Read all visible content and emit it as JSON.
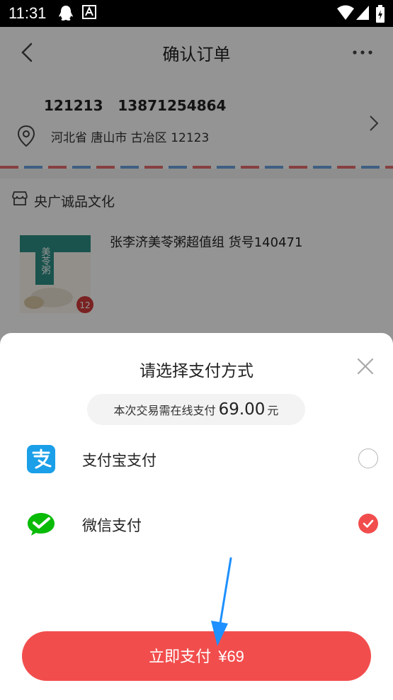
{
  "status_bar": {
    "time": "11:31"
  },
  "nav": {
    "title": "确认订单"
  },
  "address": {
    "name": "121213",
    "phone": "13871254864",
    "detail": "河北省 唐山市 古冶区  12123"
  },
  "store": {
    "name": "央广诚品文化"
  },
  "product": {
    "title": "张李济美苓粥超值组 货号140471",
    "image_text": "美苓粥",
    "badge": "12"
  },
  "sheet": {
    "title": "请选择支付方式",
    "amount_prefix": "本次交易需在线支付",
    "amount": "69.00",
    "amount_unit": "元",
    "methods": [
      {
        "label": "支付宝支付",
        "selected": false,
        "icon": "alipay-icon"
      },
      {
        "label": "微信支付",
        "selected": true,
        "icon": "wechat-pay-icon"
      }
    ],
    "pay_label": "立即支付",
    "pay_amount": "¥69"
  },
  "colors": {
    "accent": "#f24d4d",
    "alipay": "#1a9fe8",
    "wechat": "#09bb07",
    "annotation_arrow": "#1e90ff"
  }
}
